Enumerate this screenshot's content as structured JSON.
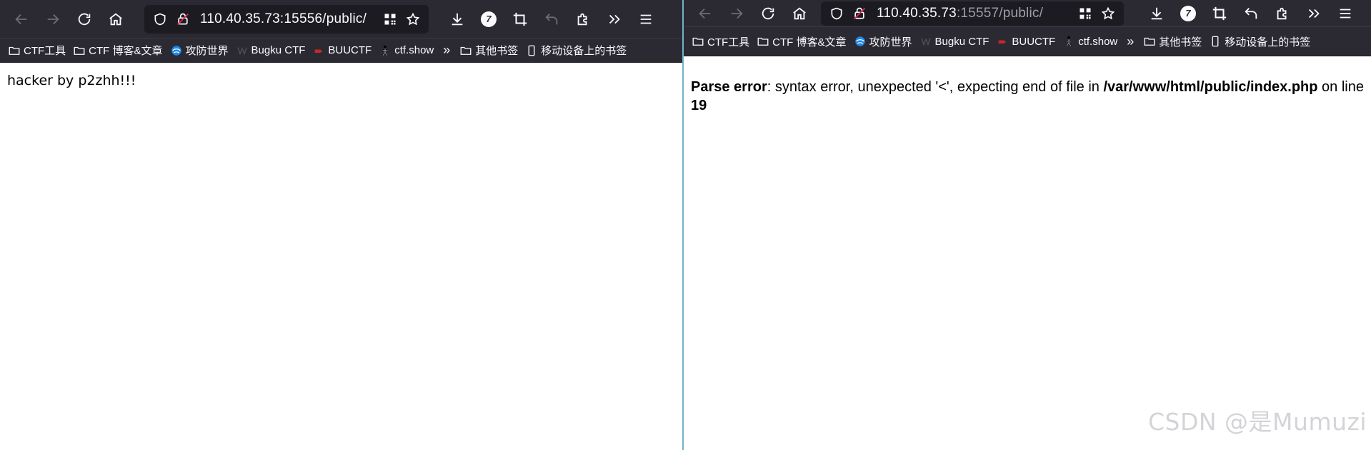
{
  "left": {
    "url_host": "110.40.35.73:15556/public/",
    "url_path": "",
    "badge": "7",
    "bookmarks": [
      {
        "label": "CTF工具",
        "icon": "folder-icon"
      },
      {
        "label": "CTF 博客&文章",
        "icon": "folder-icon"
      },
      {
        "label": "攻防世界",
        "icon": "globe-logo-icon"
      },
      {
        "label": "Bugku CTF",
        "icon": "bugku-logo-icon"
      },
      {
        "label": "BUUCTF",
        "icon": "buuctf-logo-icon"
      },
      {
        "label": "ctf.show",
        "icon": "ctfshow-logo-icon"
      },
      {
        "label": "其他书签",
        "icon": "folder-icon"
      },
      {
        "label": "移动设备上的书签",
        "icon": "mobile-icon"
      }
    ],
    "overflow": "»",
    "body_text": "hacker by p2zhh!!!"
  },
  "right": {
    "url_host": "110.40.35.73",
    "url_path": ":15557/public/",
    "badge": "7",
    "bookmarks": [
      {
        "label": "CTF工具",
        "icon": "folder-icon"
      },
      {
        "label": "CTF 博客&文章",
        "icon": "folder-icon"
      },
      {
        "label": "攻防世界",
        "icon": "globe-logo-icon"
      },
      {
        "label": "Bugku CTF",
        "icon": "bugku-logo-icon"
      },
      {
        "label": "BUUCTF",
        "icon": "buuctf-logo-icon"
      },
      {
        "label": "ctf.show",
        "icon": "ctfshow-logo-icon"
      },
      {
        "label": "其他书签",
        "icon": "folder-icon"
      },
      {
        "label": "移动设备上的书签",
        "icon": "mobile-icon"
      }
    ],
    "overflow": "»",
    "error": {
      "label": "Parse error",
      "message": ": syntax error, unexpected '<', expecting end of file in ",
      "file": "/var/www/html/public/index.php",
      "line_text": " on line ",
      "line": "19"
    }
  },
  "watermark": "CSDN @是Mumuzi",
  "colors": {
    "toolbar_bg": "#2b2a33",
    "urlbar_bg": "#1c1b22",
    "divider": "#6fb3c7",
    "text_light": "#fbfbfe"
  }
}
